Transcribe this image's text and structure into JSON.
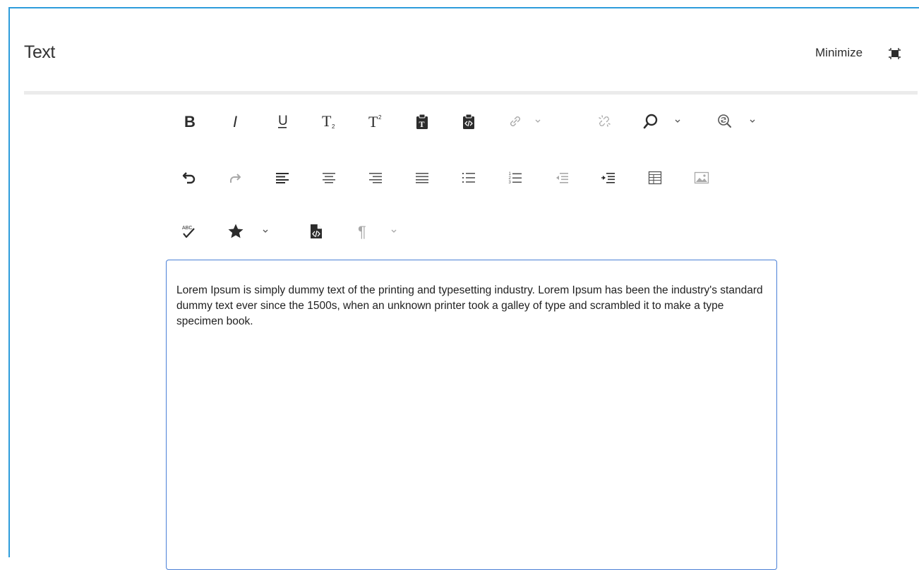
{
  "panel": {
    "title": "Text",
    "minimize_label": "Minimize"
  },
  "toolbar": {
    "row1": [
      "bold-icon",
      "italic-icon",
      "underline-icon",
      "subscript-icon",
      "superscript-icon",
      "paste-text-icon",
      "paste-html-icon",
      "link-icon",
      "unlink-icon",
      "find-icon",
      "find-replace-icon"
    ],
    "row2": [
      "undo-icon",
      "redo-icon",
      "align-left-icon",
      "align-center-icon",
      "align-right-icon",
      "justify-icon",
      "bullet-list-icon",
      "numbered-list-icon",
      "outdent-icon",
      "indent-icon",
      "table-icon",
      "image-icon"
    ],
    "row3": [
      "spellcheck-icon",
      "special-char-icon",
      "source-edit-icon",
      "paragraph-format-icon"
    ],
    "labels": {
      "bold": "B",
      "italic": "I",
      "underline": "U",
      "subscript": "T",
      "subscript_mark": "2",
      "superscript": "T",
      "superscript_mark": "2",
      "paste_text_letter": "T",
      "spellcheck_text": "ABC",
      "pilcrow": "¶",
      "numbers": [
        "1",
        "2",
        "3"
      ]
    }
  },
  "editor": {
    "content": "Lorem Ipsum is simply dummy text of the printing and typesetting industry. Lorem Ipsum has been the industry's standard dummy text ever since the 1500s, when an unknown printer took a galley of type and scrambled it to make a type specimen book."
  },
  "colors": {
    "accent": "#2d9cdb",
    "editor_border": "#4a7fd6",
    "icon_dark": "#2c2c2c",
    "icon_disabled": "#a8a8a8"
  }
}
